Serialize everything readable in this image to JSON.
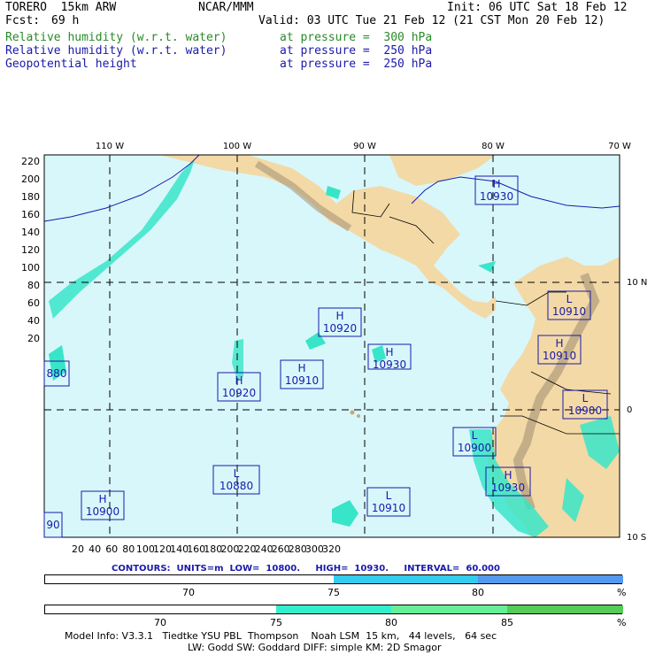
{
  "header": {
    "model": "TORERO  15km ARW",
    "org": "NCAR/MMM",
    "init": "Init: 06 UTC Sat 18 Feb 12",
    "fcst_label": "Fcst:",
    "fcst_value": "69 h",
    "valid": "Valid: 03 UTC Tue 21 Feb 12 (21 CST Mon 20 Feb 12)"
  },
  "fields": [
    {
      "name": "Relative humidity (w.r.t. water)",
      "level": "at pressure =  300 hPa",
      "color": "#2a8a2a"
    },
    {
      "name": "Relative humidity (w.r.t. water)",
      "level": "at pressure =  250 hPa",
      "color": "#1a1aaa"
    },
    {
      "name": "Geopotential height",
      "level": "at pressure =  250 hPa",
      "color": "#1a1aaa"
    }
  ],
  "map": {
    "top_lon_labels": [
      "110 W",
      "100 W",
      "90 W",
      "80 W",
      "70 W"
    ],
    "right_lat_labels": [
      "10 N",
      "0",
      "10 S"
    ],
    "left_y_ticks": [
      "220",
      "200",
      "180",
      "160",
      "140",
      "120",
      "100",
      "80",
      "60",
      "40",
      "20"
    ],
    "bottom_x_ticks": [
      "20",
      "40",
      "60",
      "80",
      "100",
      "120",
      "140",
      "160",
      "180",
      "200",
      "220",
      "240",
      "260",
      "280",
      "300",
      "320"
    ],
    "pressure_centers": [
      {
        "type": "H",
        "value": "10930"
      },
      {
        "type": "L",
        "value": "10910"
      },
      {
        "type": "H",
        "value": "10910"
      },
      {
        "type": "H",
        "value": "10920"
      },
      {
        "type": "H",
        "value": "10930"
      },
      {
        "type": "H",
        "value": "10910"
      },
      {
        "type": "H",
        "value": "10920"
      },
      {
        "type": "L",
        "value": "10900"
      },
      {
        "type": "L",
        "value": "10900"
      },
      {
        "type": "H",
        "value": "10930"
      },
      {
        "type": "L",
        "value": "10880"
      },
      {
        "type": "L",
        "value": "10910"
      },
      {
        "type": "H",
        "value": "10900"
      },
      {
        "type": "",
        "value": "880"
      },
      {
        "type": "",
        "value": "90"
      }
    ]
  },
  "contours": "CONTOURS:  UNITS=m  LOW=  10800.     HIGH=  10930.     INTERVAL=  60.000",
  "colorbar_250": {
    "ticks": [
      "70",
      "75",
      "80",
      "%"
    ],
    "colors": [
      "#ffffff",
      "#33ccee",
      "#5599ee"
    ]
  },
  "colorbar_300": {
    "ticks": [
      "70",
      "75",
      "80",
      "85",
      "%"
    ],
    "colors": [
      "#ffffff",
      "#33eecc",
      "#66ee99",
      "#55cc55"
    ]
  },
  "footer": {
    "line1": "Model Info: V3.3.1   Tiedtke YSU PBL  Thompson    Noah LSM  15 km,   44 levels,   64 sec",
    "line2": "LW: Godd SW: Goddard DIFF: simple KM: 2D Smagor"
  }
}
